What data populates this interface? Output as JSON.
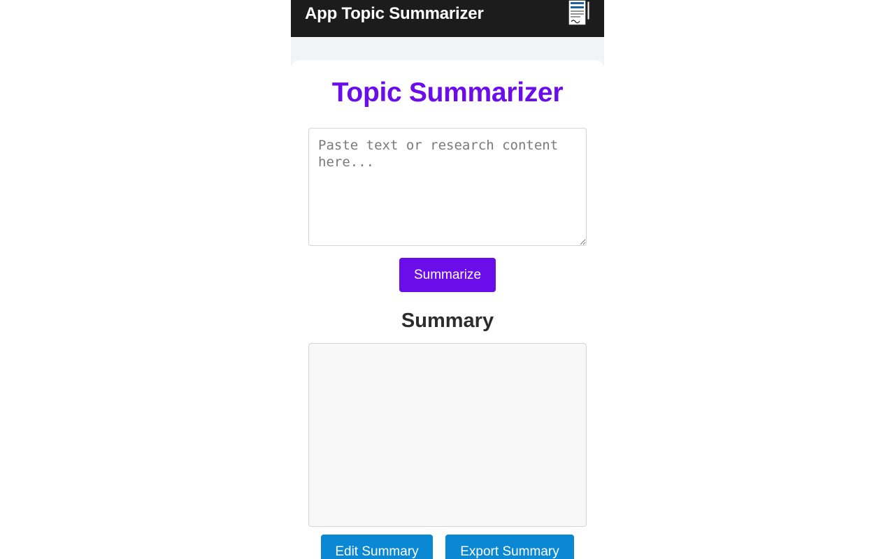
{
  "app_bar": {
    "title": "App Topic Summarizer",
    "icon": "document-pen-icon"
  },
  "main": {
    "title": "Topic Summarizer",
    "input": {
      "value": "",
      "placeholder": "Paste text or research content here..."
    },
    "summarize_label": "Summarize",
    "summary_heading": "Summary",
    "summary_text": "",
    "edit_label": "Edit Summary",
    "export_label": "Export Summary"
  },
  "colors": {
    "accent_purple": "#6a0dea",
    "action_blue": "#0a88d4",
    "app_bar": "#1c1c1c"
  }
}
